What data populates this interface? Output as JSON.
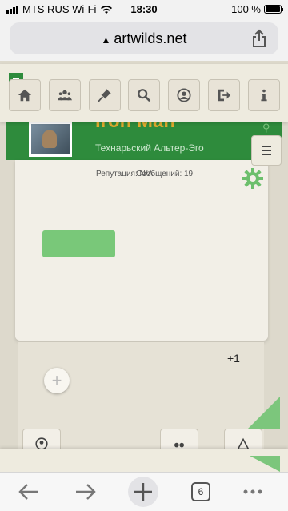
{
  "status_bar": {
    "carrier": "MTS RUS Wi-Fi",
    "time": "18:30",
    "battery": "100 %"
  },
  "address_bar": {
    "url": "artwilds.net"
  },
  "toolbar": {
    "items": [
      {
        "icon": "home-icon"
      },
      {
        "icon": "users-icon"
      },
      {
        "icon": "pin-icon"
      },
      {
        "icon": "search-icon"
      },
      {
        "icon": "user-circle-icon"
      },
      {
        "icon": "logout-icon"
      },
      {
        "icon": "info-icon"
      }
    ]
  },
  "profile": {
    "name": "Iron Man",
    "subtitle": "Технарьский Альтер-Эго",
    "stats_left": "Репутация: N/A",
    "stats_right": "Сообщений: 19"
  },
  "lower": {
    "plus_one": "+1"
  },
  "browser_nav": {
    "tabs_count": "6"
  },
  "colors": {
    "brand_green": "#2e8b3c",
    "accent_green": "#79c879",
    "name_gold": "#e0a92e"
  }
}
